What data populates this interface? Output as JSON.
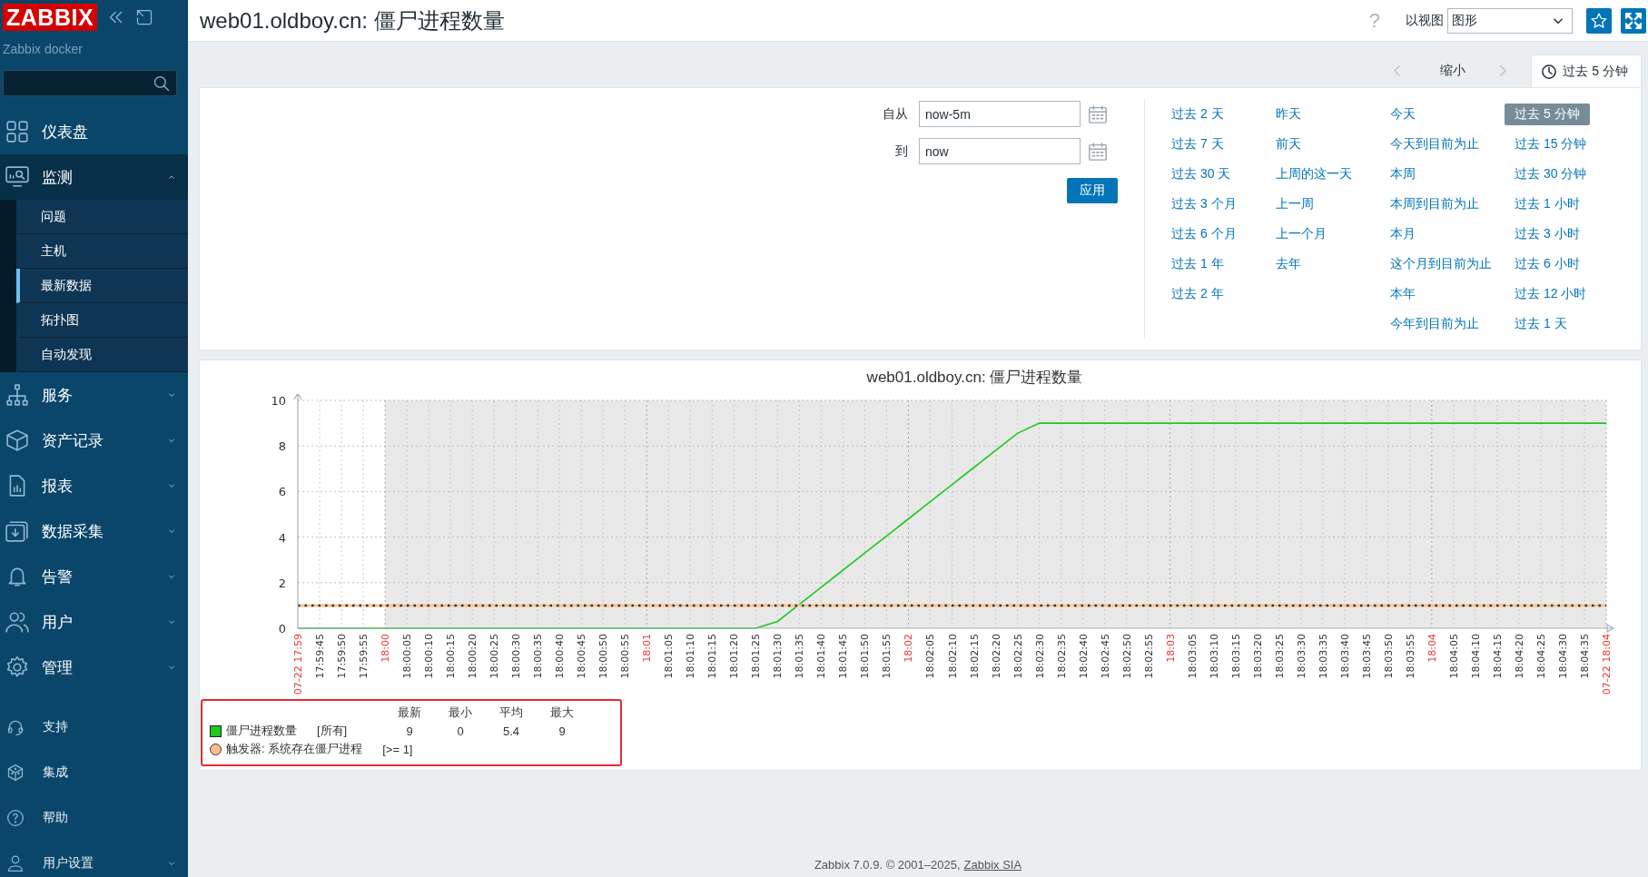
{
  "sidebar": {
    "logo": "ZABBIX",
    "server_name": "Zabbix docker",
    "menu": [
      {
        "label": "仪表盘",
        "kind": "link",
        "selected": false
      },
      {
        "label": "监测",
        "kind": "menu",
        "expanded": true,
        "selected": true,
        "children": [
          {
            "label": "问题",
            "selected": false
          },
          {
            "label": "主机",
            "selected": false
          },
          {
            "label": "最新数据",
            "selected": true
          },
          {
            "label": "拓扑图",
            "selected": false
          },
          {
            "label": "自动发现",
            "selected": false
          }
        ]
      },
      {
        "label": "服务",
        "kind": "menu",
        "expanded": false,
        "selected": false
      },
      {
        "label": "资产记录",
        "kind": "menu",
        "expanded": false,
        "selected": false
      },
      {
        "label": "报表",
        "kind": "menu",
        "expanded": false,
        "selected": false
      },
      {
        "label": "数据采集",
        "kind": "menu",
        "expanded": false,
        "selected": false
      },
      {
        "label": "告警",
        "kind": "menu",
        "expanded": false,
        "selected": false
      },
      {
        "label": "用户",
        "kind": "menu",
        "expanded": false,
        "selected": false
      },
      {
        "label": "管理",
        "kind": "menu",
        "expanded": false,
        "selected": false
      }
    ],
    "footer_menu": [
      {
        "label": "支持",
        "kind": "link"
      },
      {
        "label": "集成",
        "kind": "link"
      },
      {
        "label": "帮助",
        "kind": "link"
      },
      {
        "label": "用户设置",
        "kind": "menu",
        "expanded": false
      }
    ]
  },
  "header": {
    "title": "web01.oldboy.cn: 僵尸进程数量",
    "help": "?",
    "view_label": "以视图",
    "view_select": "图形"
  },
  "filter": {
    "zoom_out": "缩小",
    "tab": {
      "label": "过去 5 分钟",
      "selected": true
    },
    "from_label": "自从",
    "from_value": "now-5m",
    "to_label": "到",
    "to_value": "now",
    "apply": "应用",
    "presets": [
      [
        {
          "label": "过去 2 天",
          "selected": false
        },
        {
          "label": "过去 7 天",
          "selected": false
        },
        {
          "label": "过去 30 天",
          "selected": false
        },
        {
          "label": "过去 3 个月",
          "selected": false
        },
        {
          "label": "过去 6 个月",
          "selected": false
        },
        {
          "label": "过去 1 年",
          "selected": false
        },
        {
          "label": "过去 2 年",
          "selected": false
        }
      ],
      [
        {
          "label": "昨天",
          "selected": false
        },
        {
          "label": "前天",
          "selected": false
        },
        {
          "label": "上周的这一天",
          "selected": false
        },
        {
          "label": "上一周",
          "selected": false
        },
        {
          "label": "上一个月",
          "selected": false
        },
        {
          "label": "去年",
          "selected": false
        }
      ],
      [
        {
          "label": "今天",
          "selected": false
        },
        {
          "label": "今天到目前为止",
          "selected": false
        },
        {
          "label": "本周",
          "selected": false
        },
        {
          "label": "本周到目前为止",
          "selected": false
        },
        {
          "label": "本月",
          "selected": false
        },
        {
          "label": "这个月到目前为止",
          "selected": false
        },
        {
          "label": "本年",
          "selected": false
        },
        {
          "label": "今年到目前为止",
          "selected": false
        }
      ],
      [
        {
          "label": "过去 5 分钟",
          "selected": true
        },
        {
          "label": "过去 15 分钟",
          "selected": false
        },
        {
          "label": "过去 30 分钟",
          "selected": false
        },
        {
          "label": "过去 1 小时",
          "selected": false
        },
        {
          "label": "过去 3 小时",
          "selected": false
        },
        {
          "label": "过去 6 小时",
          "selected": false
        },
        {
          "label": "过去 12 小时",
          "selected": false
        },
        {
          "label": "过去 1 天",
          "selected": false
        }
      ]
    ]
  },
  "graph": {
    "chart_data": {
      "type": "line",
      "title": "web01.oldboy.cn: 僵尸进程数量",
      "categories": [
        "07-22 17:59",
        "17:59:45",
        "17:59:50",
        "17:59:55",
        "18:00",
        "18:00:05",
        "18:00:10",
        "18:00:15",
        "18:00:20",
        "18:00:25",
        "18:00:30",
        "18:00:35",
        "18:00:40",
        "18:00:45",
        "18:00:50",
        "18:00:55",
        "18:01",
        "18:01:05",
        "18:01:10",
        "18:01:15",
        "18:01:20",
        "18:01:25",
        "18:01:30",
        "18:01:35",
        "18:01:40",
        "18:01:45",
        "18:01:50",
        "18:01:55",
        "18:02",
        "18:02:05",
        "18:02:10",
        "18:02:15",
        "18:02:20",
        "18:02:25",
        "18:02:30",
        "18:02:35",
        "18:02:40",
        "18:02:45",
        "18:02:50",
        "18:02:55",
        "18:03",
        "18:03:05",
        "18:03:10",
        "18:03:15",
        "18:03:20",
        "18:03:25",
        "18:03:30",
        "18:03:35",
        "18:03:40",
        "18:03:45",
        "18:03:50",
        "18:03:55",
        "18:04",
        "18:04:05",
        "18:04:10",
        "18:04:15",
        "18:04:20",
        "18:04:25",
        "18:04:30",
        "18:04:35",
        "07-22 18:04"
      ],
      "grid": true,
      "ylim": [
        0,
        10
      ],
      "yticks": [
        0,
        2,
        4,
        6,
        8,
        10
      ],
      "series": [
        {
          "name": "僵尸进程数量",
          "color": "#1ec81e",
          "values": [
            0,
            0,
            0,
            0,
            0,
            0,
            0,
            0,
            0,
            0,
            0,
            0,
            0,
            0,
            0,
            0,
            0,
            0,
            0,
            0,
            0,
            0,
            0.3,
            1.05,
            1.8,
            2.55,
            3.3,
            4.05,
            4.8,
            5.55,
            6.3,
            7.05,
            7.8,
            8.55,
            9,
            9,
            9,
            9,
            9,
            9,
            9,
            9,
            9,
            9,
            9,
            9,
            9,
            9,
            9,
            9,
            9,
            9,
            9,
            9,
            9,
            9,
            9,
            9,
            9,
            9,
            9
          ]
        },
        {
          "name": "触发器: 系统存在僵尸进程",
          "color": "#ffbf8c",
          "values": [
            1,
            1,
            1,
            1,
            1,
            1,
            1,
            1,
            1,
            1,
            1,
            1,
            1,
            1,
            1,
            1,
            1,
            1,
            1,
            1,
            1,
            1,
            1,
            1,
            1,
            1,
            1,
            1,
            1,
            1,
            1,
            1,
            1,
            1,
            1,
            1,
            1,
            1,
            1,
            1,
            1,
            1,
            1,
            1,
            1,
            1,
            1,
            1,
            1,
            1,
            1,
            1,
            1,
            1,
            1,
            1,
            1,
            1,
            1,
            1,
            1
          ]
        }
      ]
    },
    "legend": {
      "columns": [
        "最新",
        "最小",
        "平均",
        "最大"
      ],
      "rows": [
        {
          "kind": "item",
          "tag": "[所有]",
          "cells": [
            "9",
            "0",
            "5.4",
            "9"
          ]
        },
        {
          "kind": "trigger",
          "tag": "[>= 1]"
        }
      ]
    }
  },
  "footer": {
    "text": "Zabbix 7.0.9. © 2001–2025,",
    "link": "Zabbix SIA"
  }
}
